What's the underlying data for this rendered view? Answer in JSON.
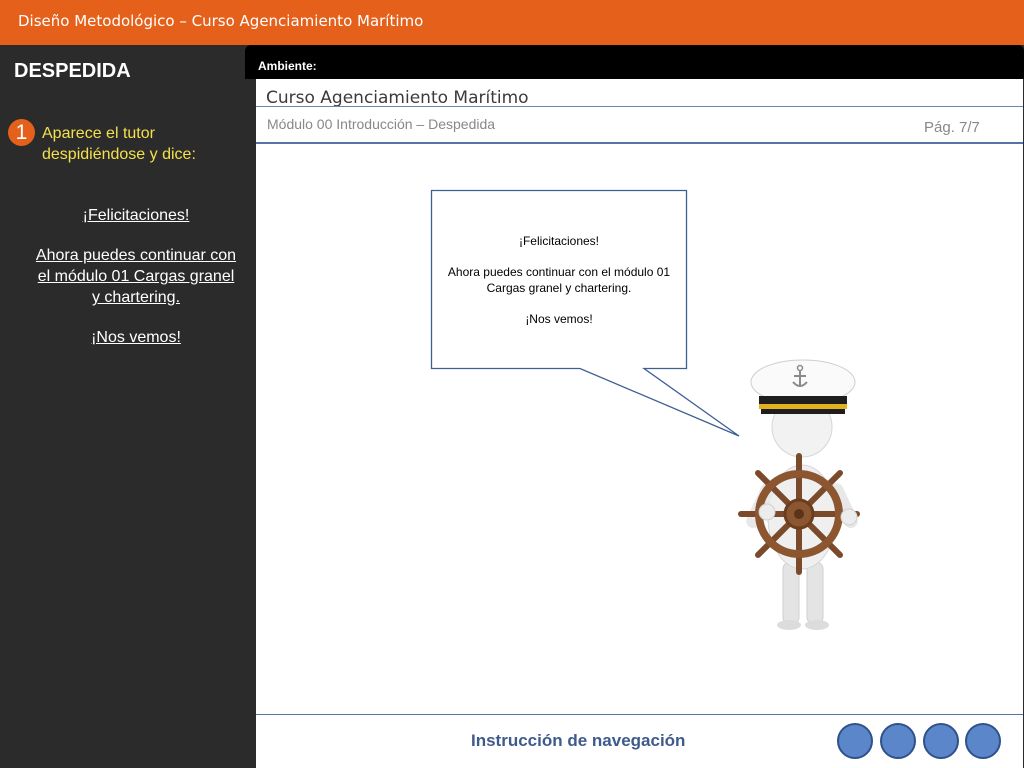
{
  "window": {
    "title": "Diseño  Metodológico – Curso Agenciamiento Marítimo"
  },
  "sidebar": {
    "heading": "DESPEDIDA",
    "step_number": "1",
    "step_text": "Aparece el tutor despidiéndose y dice:",
    "dialog": [
      "¡Felicitaciones!",
      "Ahora puedes continuar con el módulo 01 Cargas granel y chartering.",
      "¡Nos vemos!"
    ]
  },
  "stage": {
    "label": "Ambiente:"
  },
  "screen": {
    "course_title": "Curso Agenciamiento Marítimo",
    "module_label": "Módulo 00 Introducción – Despedida",
    "page": "Pág. 7/7",
    "bubble": [
      "¡Felicitaciones!",
      "Ahora puedes continuar con el módulo 01 Cargas granel y chartering.",
      "¡Nos vemos!"
    ],
    "nav_instruction": "Instrucción de navegación"
  },
  "colors": {
    "accent": "#e5601a",
    "step_text": "#f4e04d",
    "nav_button": "#5b86c9",
    "nav_text": "#3f5a8c"
  },
  "icons": {
    "tutor": "captain-tutor-figure-icon",
    "anchor": "anchor-icon",
    "wheel": "ship-wheel-icon"
  }
}
